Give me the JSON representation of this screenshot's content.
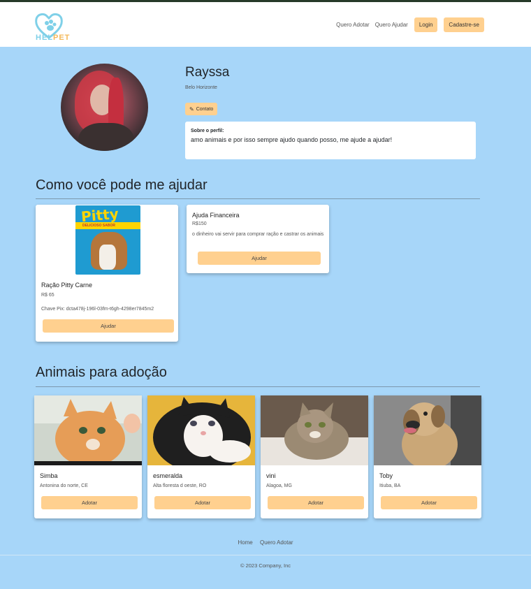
{
  "brand": {
    "name_part1": "HEL",
    "name_part2": "PET",
    "logo_icon": "heart-paw-icon"
  },
  "nav": {
    "links": [
      "Quero Adotar",
      "Quero Ajudar"
    ],
    "login": "Login",
    "signup": "Cadastre-se"
  },
  "profile": {
    "name": "Rayssa",
    "city": "Belo Horizonte",
    "contact_label": "Contato",
    "contact_icon": "edit-icon",
    "about_title": "Sobre o perfil:",
    "about_text": "amo animais e por isso sempre ajudo quando posso, me ajude a ajudar!"
  },
  "help_section": {
    "title": "Como você pode me ajudar",
    "cards": [
      {
        "title": "Ração Pitty Carne",
        "price": "R$ 65",
        "detail": "Chave Pix: dcta478j-196l-03fm-t6gh-4298er7845m2",
        "button": "Ajudar",
        "image_text": "Pitty",
        "image_band_text": "DELICIOSO SABOR"
      },
      {
        "title": "Ajuda Financeira",
        "price": "R$150",
        "detail": "o dinheiro vai servir para comprar ração e castrar os animais",
        "button": "Ajudar"
      }
    ]
  },
  "adoption_section": {
    "title": "Animais para adoção",
    "animals": [
      {
        "name": "Simba",
        "location": "Antonina do norte, CE",
        "button": "Adotar"
      },
      {
        "name": "esmeralda",
        "location": "Alta floresta d oeste, RO",
        "button": "Adotar"
      },
      {
        "name": "vini",
        "location": "Alagoa, MG",
        "button": "Adotar"
      },
      {
        "name": "Toby",
        "location": "Itiuba, BA",
        "button": "Adotar"
      }
    ]
  },
  "footer": {
    "links": [
      "Home",
      "Quero Adotar"
    ],
    "copyright": "© 2023 Company, Inc"
  },
  "colors": {
    "background": "#a7d6f9",
    "accent": "#ffd08f",
    "logo_blue": "#7fd0e8",
    "logo_orange": "#f4b95b"
  }
}
